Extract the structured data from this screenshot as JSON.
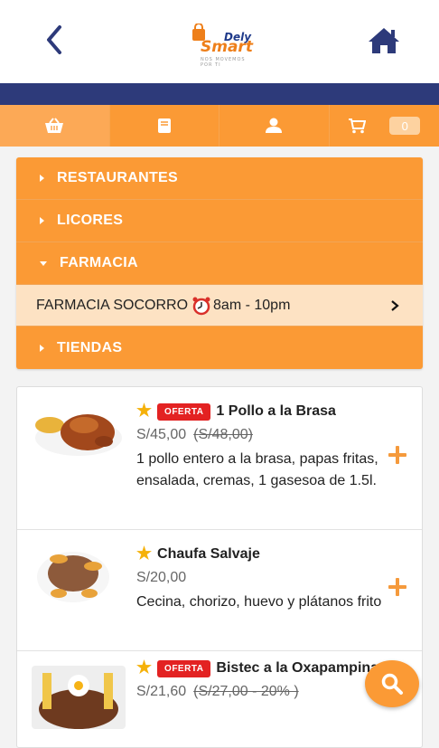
{
  "header": {
    "back_icon": "chevron-left-icon",
    "home_icon": "home-icon",
    "logo": {
      "line1": "Dely",
      "line2": "Smart",
      "tagline": "NOS MOVEMOS POR TI"
    }
  },
  "colors": {
    "primary": "#fb9a35",
    "navy": "#2d3a7a",
    "accent_red": "#e32222",
    "star": "#f5b10a"
  },
  "tabs": [
    {
      "icon": "basket-icon"
    },
    {
      "icon": "book-icon"
    },
    {
      "icon": "user-icon"
    },
    {
      "icon": "cart-icon",
      "count": "0"
    }
  ],
  "categories": {
    "restaurantes": "RESTAURANTES",
    "licores": "LICORES",
    "farmacia": "FARMACIA",
    "farmacia_sub": {
      "name": "FARMACIA SOCORRO",
      "hours": "8am - 10pm"
    },
    "tiendas": "TIENDAS"
  },
  "products": [
    {
      "name": "1 Pollo a la Brasa",
      "badge": "OFERTA",
      "price": "S/45,00",
      "old_price": "(S/48,00)",
      "description": "1 pollo entero a la brasa, papas fritas, ensalada, cremas, 1 gasesoa de 1.5l."
    },
    {
      "name": "Chaufa Salvaje",
      "price": "S/20,00",
      "description": "Cecina, chorizo, huevo y plátanos frito"
    },
    {
      "name": "Bistec a la Oxapampina",
      "badge": "OFERTA",
      "price": "S/21,60",
      "old_price": "(S/27,00 - 20% )"
    }
  ]
}
